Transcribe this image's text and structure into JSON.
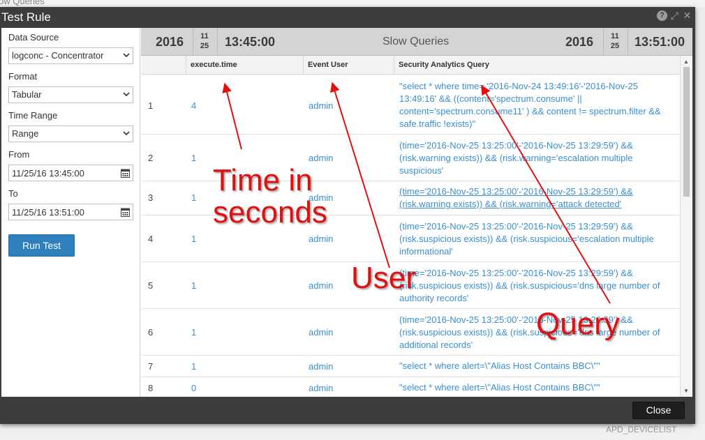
{
  "background": {
    "top_text": "ow Queries",
    "bottom_text": "APD_DEVICELIST"
  },
  "modal": {
    "title": "Test Rule",
    "icons": [
      "help-icon",
      "expand-icon",
      "close-icon"
    ]
  },
  "form": {
    "data_source_label": "Data Source",
    "data_source_value": "logconc - Concentrator",
    "format_label": "Format",
    "format_value": "Tabular",
    "time_range_label": "Time Range",
    "time_range_value": "Range",
    "from_label": "From",
    "from_value": "11/25/16 13:45:00",
    "to_label": "To",
    "to_value": "11/25/16 13:51:00",
    "run_button": "Run Test"
  },
  "results": {
    "start_year": "2016",
    "start_month": "11",
    "start_day": "25",
    "start_time": "13:45:00",
    "title": "Slow Queries",
    "end_year": "2016",
    "end_month": "11",
    "end_day": "25",
    "end_time": "13:51:00",
    "columns": [
      "",
      "execute.time",
      "Event User",
      "Security Analytics Query"
    ],
    "rows": [
      {
        "num": "1",
        "time": "4",
        "user": "admin",
        "query": " \"select * where time= '2016-Nov-24 13:49:16'-'2016-Nov-25 13:49:16' && ((content='spectrum.consume' || content='spectrum.consume11' ) && content != spectrum.filter && safe.traffic !exists)\""
      },
      {
        "num": "2",
        "time": "1",
        "user": "admin",
        "query": " (time='2016-Nov-25 13:25:00'-'2016-Nov-25 13:29:59') && (risk.warning exists)) && (risk.warning='escalation multiple suspicious'"
      },
      {
        "num": "3",
        "time": "1",
        "user": "admin",
        "query": "(time='2016-Nov-25 13:25:00'-'2016-Nov-25 13:29:59') && (risk.warning exists)) && (risk.warning='attack detected'"
      },
      {
        "num": "4",
        "time": "1",
        "user": "admin",
        "query": " (time='2016-Nov-25 13:25:00'-'2016-Nov-25 13:29:59') && (risk.suspicious exists)) && (risk.suspicious='escalation multiple informational'"
      },
      {
        "num": "5",
        "time": "1",
        "user": "admin",
        "query": " (time='2016-Nov-25 13:25:00'-'2016-Nov-25 13:29:59') && (risk.suspicious exists)) && (risk.suspicious='dns large number of authority records'"
      },
      {
        "num": "6",
        "time": "1",
        "user": "admin",
        "query": " (time='2016-Nov-25 13:25:00'-'2016-Nov-25 13:29:59') && (risk.suspicious exists)) && (risk.suspicious='dns large number of additional records'"
      },
      {
        "num": "7",
        "time": "1",
        "user": "admin",
        "query": " \"select * where alert=\\\"Alias Host Contains BBC\\\"\""
      },
      {
        "num": "8",
        "time": "0",
        "user": "admin",
        "query": " \"select * where alert=\\\"Alias Host Contains BBC\\\"\""
      }
    ]
  },
  "footer": {
    "close_button": "Close"
  },
  "annotations": {
    "time_label_line1": "Time in",
    "time_label_line2": "seconds",
    "user_label": "User",
    "query_label": "Query",
    "color": "#e01010"
  }
}
